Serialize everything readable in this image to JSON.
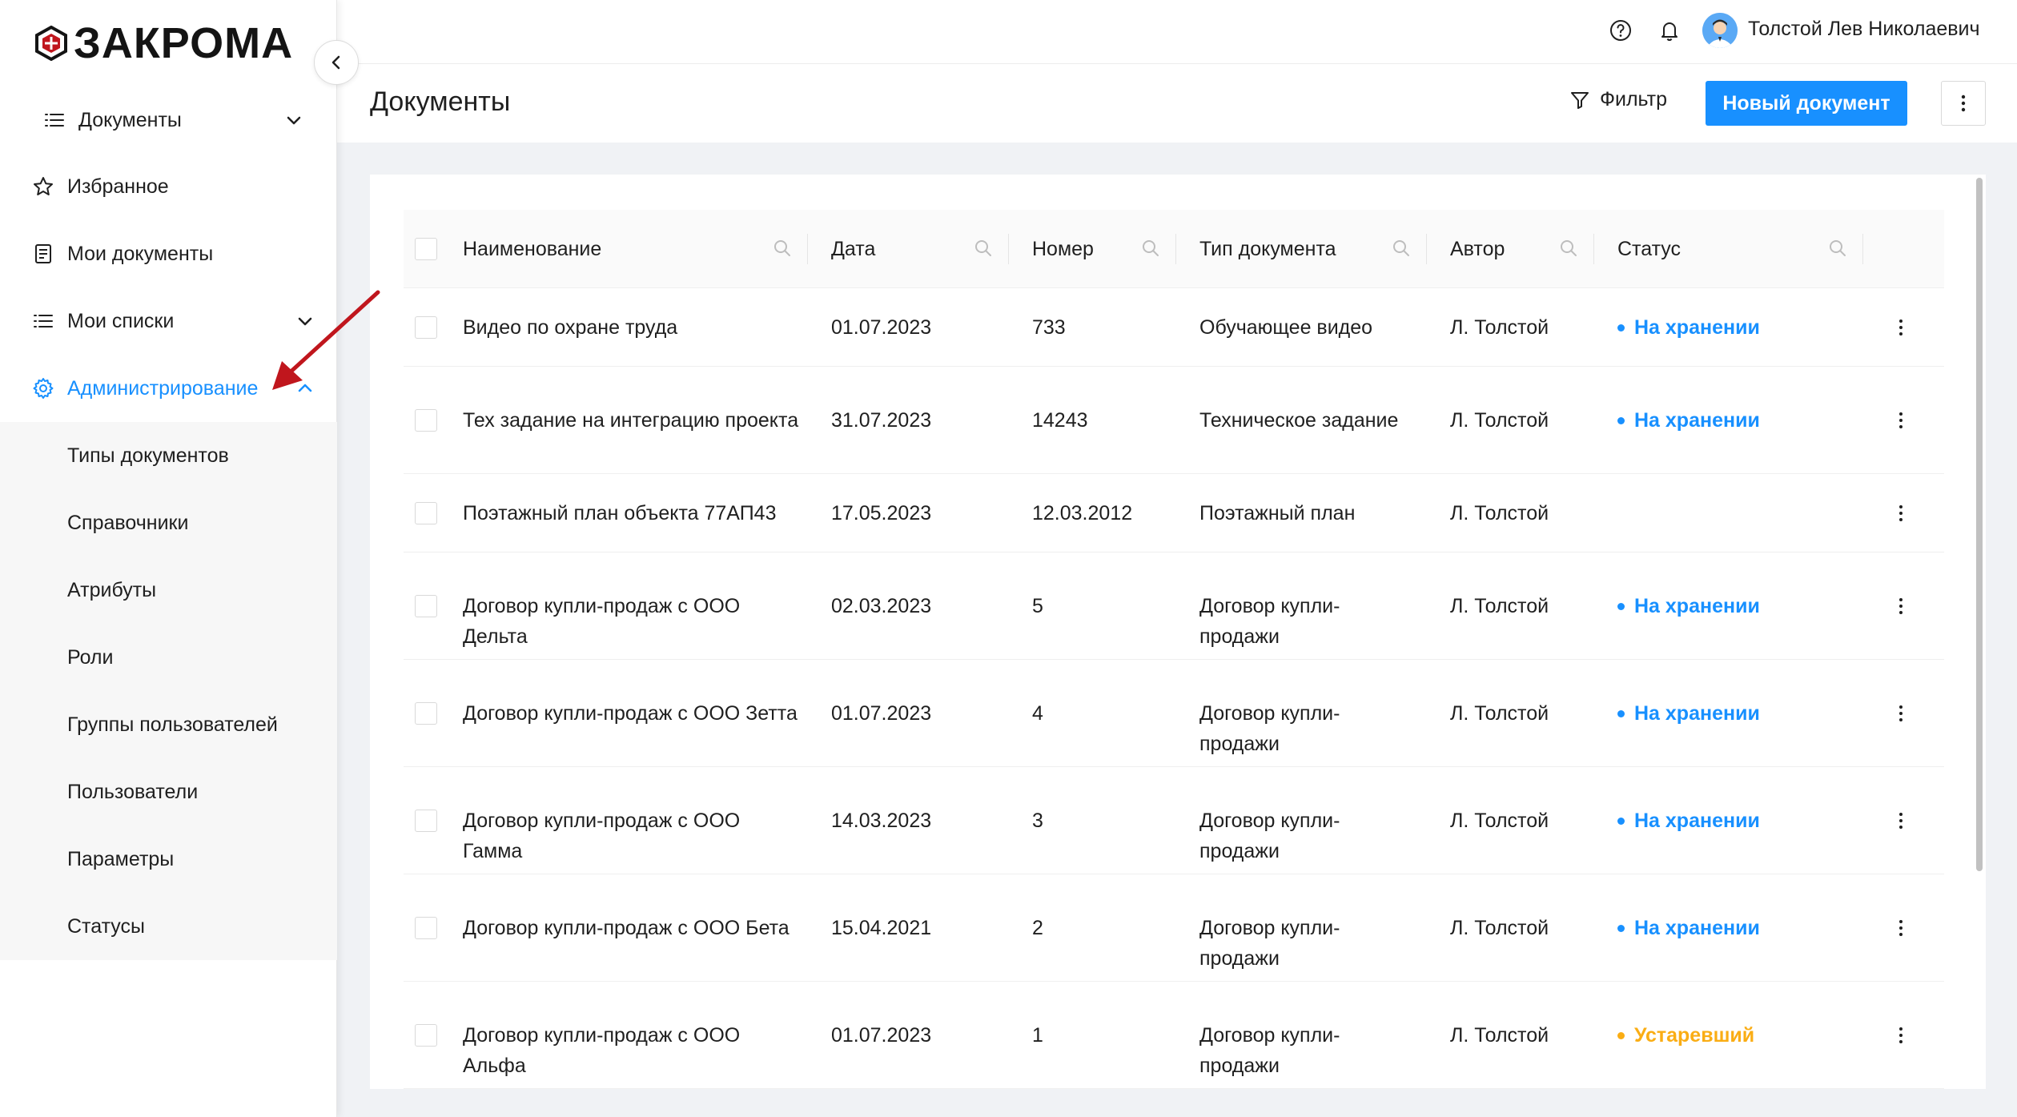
{
  "app": {
    "brand": "ЗАКРОМА"
  },
  "sidebar": {
    "items": [
      {
        "label": "Документы",
        "icon": "list-icon",
        "chevron": "down"
      },
      {
        "label": "Избранное",
        "icon": "star-icon"
      },
      {
        "label": "Мои документы",
        "icon": "document-icon"
      },
      {
        "label": "Мои списки",
        "icon": "list-icon",
        "chevron": "down"
      },
      {
        "label": "Администрирование",
        "icon": "gear-icon",
        "chevron": "up",
        "active": true
      }
    ],
    "submenu": [
      {
        "label": "Типы документов"
      },
      {
        "label": "Справочники"
      },
      {
        "label": "Атрибуты"
      },
      {
        "label": "Роли"
      },
      {
        "label": "Группы пользователей"
      },
      {
        "label": "Пользователи"
      },
      {
        "label": "Параметры"
      },
      {
        "label": "Статусы"
      }
    ]
  },
  "header": {
    "user_name": "Толстой Лев Николаевич",
    "help_icon": "help-circle-icon",
    "bell_icon": "bell-icon"
  },
  "page": {
    "title": "Документы",
    "filter_label": "Фильтр",
    "new_document_label": "Новый документ"
  },
  "colors": {
    "accent": "#1890ff",
    "status_stored": "#1890ff",
    "status_outdated": "#faad14",
    "annotation": "#c0161d"
  },
  "table": {
    "columns": [
      {
        "label": "Наименование"
      },
      {
        "label": "Дата"
      },
      {
        "label": "Номер"
      },
      {
        "label": "Тип документа"
      },
      {
        "label": "Автор"
      },
      {
        "label": "Статус"
      }
    ],
    "rows": [
      {
        "name": "Видео по охране труда",
        "date": "01.07.2023",
        "number": "733",
        "type": "Обучающее видео",
        "author": "Л. Толстой",
        "status": "На хранении",
        "status_kind": "stored"
      },
      {
        "name": "Тех задание на интеграцию проекта",
        "date": "31.07.2023",
        "number": "14243",
        "type": "Техническое задание",
        "author": "Л. Толстой",
        "status": "На хранении",
        "status_kind": "stored"
      },
      {
        "name": "Поэтажный план объекта 77АП43",
        "date": "17.05.2023",
        "number": "12.03.2012",
        "type": "Поэтажный план",
        "author": "Л. Толстой",
        "status": "",
        "status_kind": "none"
      },
      {
        "name": "Договор купли-продаж с ООО Дельта",
        "date": "02.03.2023",
        "number": "5",
        "type": "Договор купли-продажи",
        "author": "Л. Толстой",
        "status": "На хранении",
        "status_kind": "stored"
      },
      {
        "name": "Договор купли-продаж с ООО Зетта",
        "date": "01.07.2023",
        "number": "4",
        "type": "Договор купли-продажи",
        "author": "Л. Толстой",
        "status": "На хранении",
        "status_kind": "stored"
      },
      {
        "name": "Договор купли-продаж с ООО Гамма",
        "date": "14.03.2023",
        "number": "3",
        "type": "Договор купли-продажи",
        "author": "Л. Толстой",
        "status": "На хранении",
        "status_kind": "stored"
      },
      {
        "name": "Договор купли-продаж с ООО Бета",
        "date": "15.04.2021",
        "number": "2",
        "type": "Договор купли-продажи",
        "author": "Л. Толстой",
        "status": "На хранении",
        "status_kind": "stored"
      },
      {
        "name": "Договор купли-продаж с ООО Альфа",
        "date": "01.07.2023",
        "number": "1",
        "type": "Договор купли-продажи",
        "author": "Л. Толстой",
        "status": "Устаревший",
        "status_kind": "outdated"
      }
    ]
  }
}
